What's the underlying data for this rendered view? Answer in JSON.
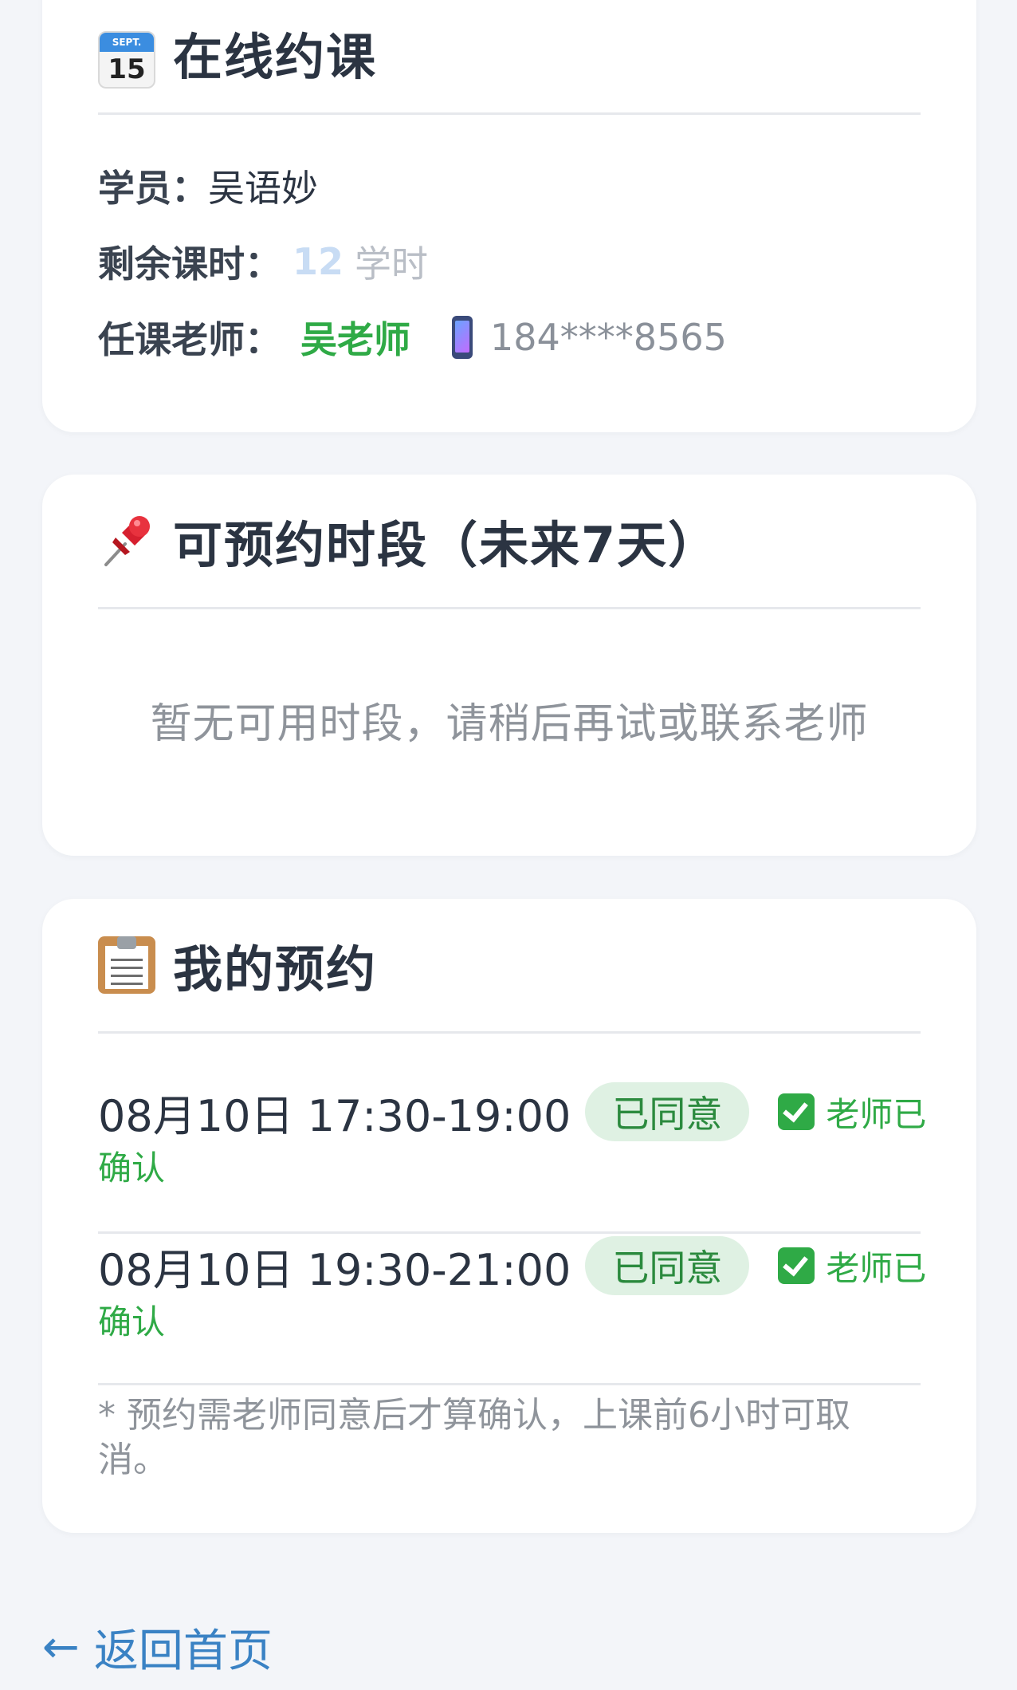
{
  "course_card": {
    "title": "在线约课",
    "icon": "calendar-icon",
    "calendar_month": "SEPT.",
    "calendar_day": "15",
    "student_label": "学员：",
    "student_name": "吴语妙",
    "hours_label": "剩余课时：",
    "hours_value": "12",
    "hours_unit": "学时",
    "teacher_label": "任课老师：",
    "teacher_name": "吴老师",
    "phone": "184****8565"
  },
  "slots_card": {
    "title": "可预约时段（未来7天）",
    "icon": "pushpin-icon",
    "empty_message": "暂无可用时段，请稍后再试或联系老师"
  },
  "bookings_card": {
    "title": "我的预约",
    "icon": "clipboard-icon",
    "items": [
      {
        "time": "08月10日 17:30-19:00",
        "status": "已同意",
        "confirm_a": "老师已",
        "confirm_b": "确认"
      },
      {
        "time": "08月10日 19:30-21:00",
        "status": "已同意",
        "confirm_a": "老师已",
        "confirm_b": "确认"
      }
    ],
    "note": "* 预约需老师同意后才算确认，上课前6小时可取消。"
  },
  "back_link": {
    "arrow": "←",
    "label": "返回首页"
  },
  "colors": {
    "accent_green": "#2faa46",
    "link_blue": "#3a82c4",
    "badge_bg": "#dff1e3"
  }
}
